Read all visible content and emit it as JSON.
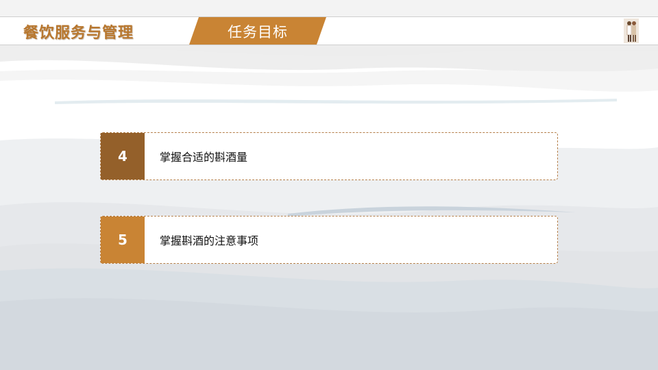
{
  "header": {
    "course_title": "餐饮服务与管理",
    "section_tab": "任务目标"
  },
  "goals": [
    {
      "number": "4",
      "text": "掌握合适的斟酒量"
    },
    {
      "number": "5",
      "text": "掌握斟酒的注意事项"
    }
  ],
  "colors": {
    "brand_orange": "#c98434",
    "brand_dark": "#94602a",
    "title_text": "#b8772e",
    "wave_gray": "#d3d9df"
  },
  "icons": {
    "corner_figure": "person-illustration-icon"
  }
}
